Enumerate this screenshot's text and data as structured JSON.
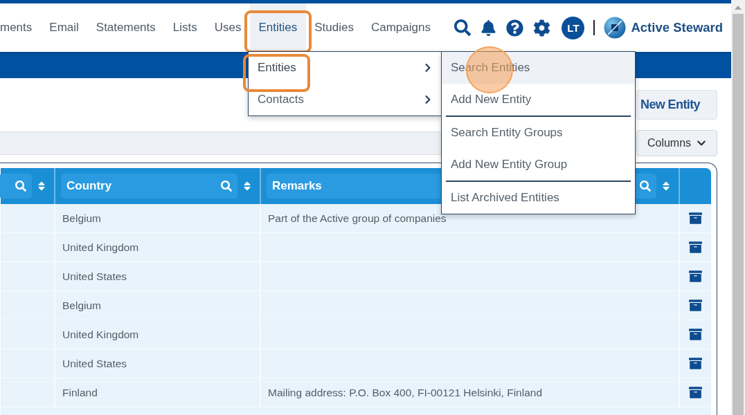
{
  "nav": {
    "items": [
      {
        "label": "ments",
        "selected": false,
        "highlighted": false
      },
      {
        "label": "Email",
        "selected": false,
        "highlighted": false
      },
      {
        "label": "Statements",
        "selected": false,
        "highlighted": false
      },
      {
        "label": "Lists",
        "selected": false,
        "highlighted": false
      },
      {
        "label": "Uses",
        "selected": false,
        "highlighted": false
      },
      {
        "label": "Entities",
        "selected": true,
        "highlighted": true
      },
      {
        "label": "Studies",
        "selected": false,
        "highlighted": false
      },
      {
        "label": "Campaigns",
        "selected": false,
        "highlighted": false
      }
    ],
    "avatar": "LT",
    "brand": "Active Steward"
  },
  "menu": {
    "items": [
      {
        "label": "Entities",
        "selected": true,
        "highlighted": true
      },
      {
        "label": "Contacts",
        "selected": false,
        "highlighted": false
      }
    ]
  },
  "submenu": {
    "items": [
      {
        "label": "Search Entities",
        "selected": true,
        "clicked": true,
        "separator_after": false
      },
      {
        "label": "Add New Entity",
        "selected": false,
        "clicked": false,
        "separator_after": true
      },
      {
        "label": "Search Entity Groups",
        "selected": false,
        "clicked": false,
        "separator_after": false
      },
      {
        "label": "Add New Entity Group",
        "selected": false,
        "clicked": false,
        "separator_after": true
      },
      {
        "label": "List Archived Entities",
        "selected": false,
        "clicked": false,
        "separator_after": false
      }
    ]
  },
  "add_button": "New Entity",
  "columns_button": "Columns",
  "table": {
    "columns": [
      {
        "kind": "unlabeled"
      },
      {
        "kind": "labeled",
        "label": "Country"
      },
      {
        "kind": "labeled",
        "label": "Remarks"
      },
      {
        "kind": "action"
      }
    ],
    "rows": [
      {
        "country": "Belgium",
        "remarks": "Part of the Active group of companies"
      },
      {
        "country": "United Kingdom"
      },
      {
        "country": "United States"
      },
      {
        "country": "Belgium"
      },
      {
        "country": "United Kingdom"
      },
      {
        "country": "United States"
      },
      {
        "country": "Finland",
        "remarks": "Mailing address: P.O. Box 400, FI-00121 Helsinki, Finland"
      }
    ]
  }
}
